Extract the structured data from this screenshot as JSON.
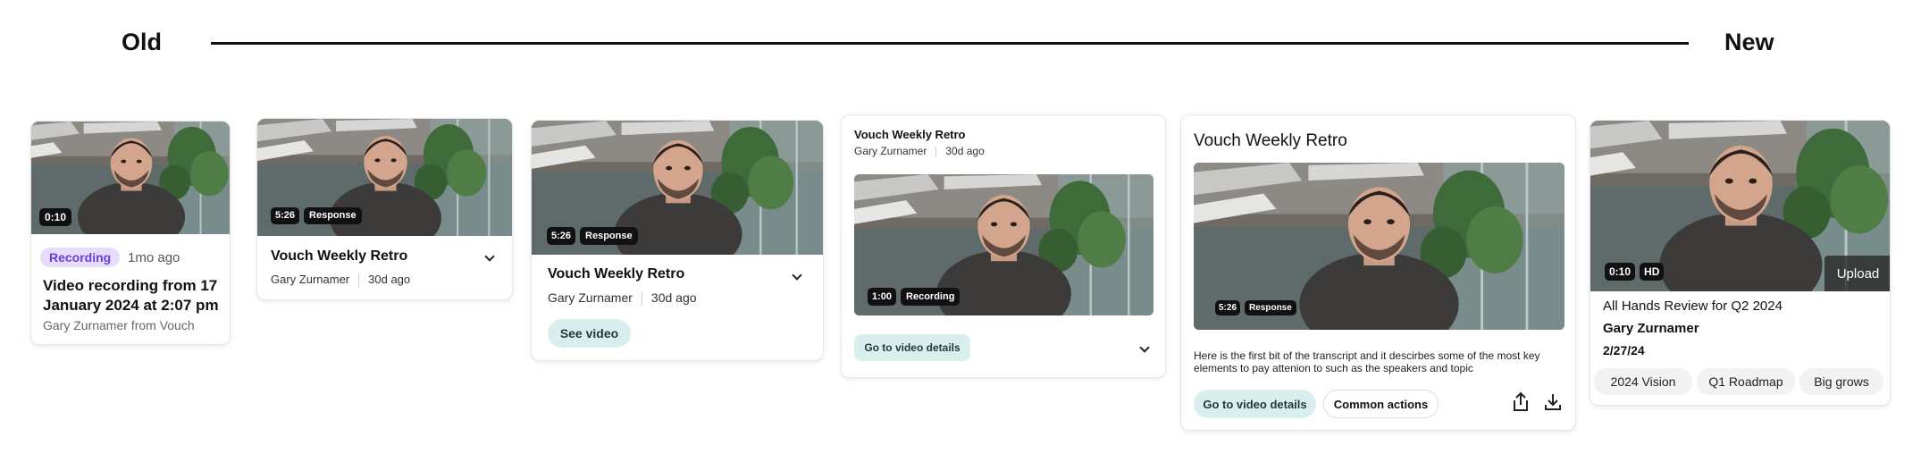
{
  "timeline": {
    "old_label": "Old",
    "new_label": "New"
  },
  "card1": {
    "duration": "0:10",
    "status_badge": "Recording",
    "age": "1mo ago",
    "title_line1": "Video recording from 17",
    "title_line2": "January 2024 at 2:07 pm",
    "byline": "Gary Zurnamer from Vouch"
  },
  "card2": {
    "duration": "5:26",
    "badge": "Response",
    "title": "Vouch Weekly Retro",
    "author": "Gary Zurnamer",
    "age": "30d ago"
  },
  "card3": {
    "duration": "5:26",
    "badge": "Response",
    "title": "Vouch Weekly Retro",
    "author": "Gary Zurnamer",
    "age": "30d ago",
    "button": "See video"
  },
  "card4": {
    "title": "Vouch Weekly Retro",
    "author": "Gary Zurnamer",
    "age": "30d ago",
    "duration": "1:00",
    "badge": "Recording",
    "button": "Go to video details"
  },
  "card5": {
    "title": "Vouch Weekly Retro",
    "duration": "5:26",
    "badge": "Response",
    "transcript_line1": "Here is the first bit of the transcript and it descirbes some of the most key",
    "transcript_line2": "elements to pay attenion to such as the speakers and topic",
    "primary_button": "Go to video details",
    "secondary_button": "Common actions",
    "icons": [
      "share-icon",
      "download-icon"
    ]
  },
  "card6": {
    "duration": "0:10",
    "quality": "HD",
    "upload_label": "Upload",
    "title": "All Hands Review for Q2 2024",
    "author": "Gary Zurnamer",
    "date": "2/27/24",
    "tags": [
      "2024 Vision",
      "Q1 Roadmap",
      "Big grows"
    ]
  },
  "colors": {
    "recording_badge_bg": "#e6dcfb",
    "recording_badge_text": "#6b3fd6",
    "teal_button_bg": "#d9efee"
  }
}
